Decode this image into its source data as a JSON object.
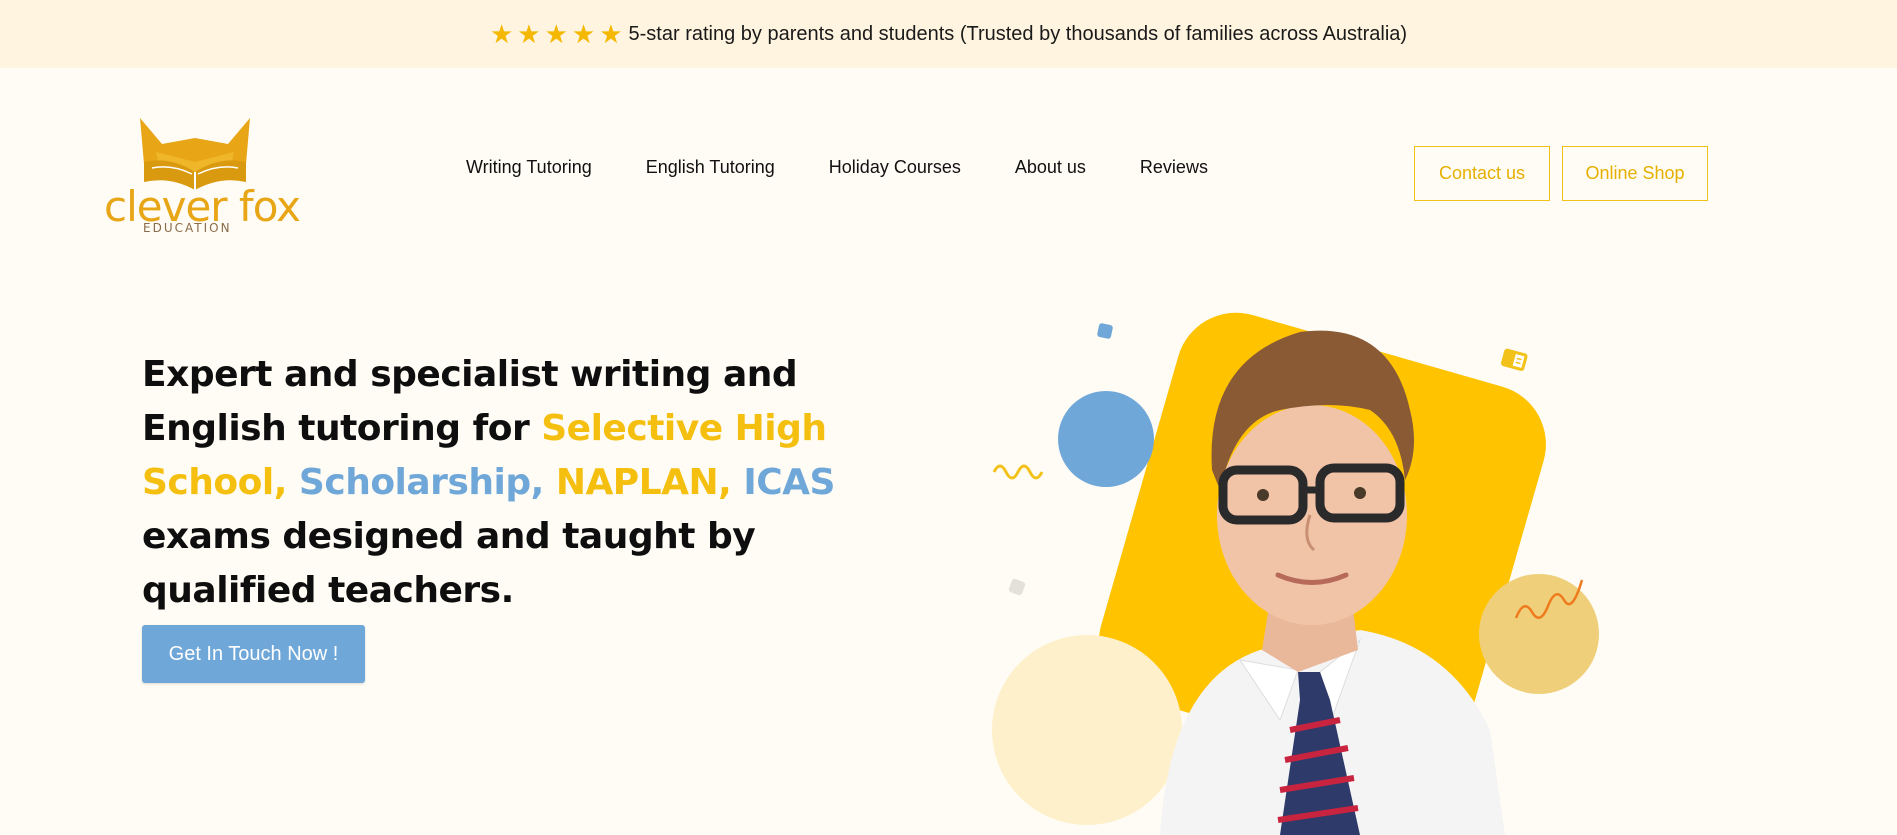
{
  "topbar": {
    "stars": [
      "★",
      "★",
      "★",
      "★",
      "★"
    ],
    "rating_text": "5-star rating by parents and students (Trusted by thousands of families across Australia)"
  },
  "logo": {
    "name": "clever fox",
    "subtitle": "EDUCATION"
  },
  "nav": {
    "items": [
      {
        "label": "Writing Tutoring"
      },
      {
        "label": "English Tutoring"
      },
      {
        "label": "Holiday Courses"
      },
      {
        "label": "About us"
      },
      {
        "label": "Reviews"
      }
    ]
  },
  "header_buttons": {
    "contact": "Contact us",
    "shop": "Online Shop"
  },
  "hero": {
    "part1": "Expert and specialist writing and English tutoring for ",
    "selective": "Selective High School,",
    "scholarship": " Scholarship,",
    "naplan": " NAPLAN,",
    "icas": " ICAS",
    "part2": " exams designed and taught by qualified teachers.",
    "cta": "Get In Touch Now !"
  },
  "colors": {
    "brand_yellow": "#F5BF0F",
    "brand_blue": "#6FA7D8",
    "background": "#FFFCF5",
    "topbar_bg": "#FFF4DF"
  }
}
